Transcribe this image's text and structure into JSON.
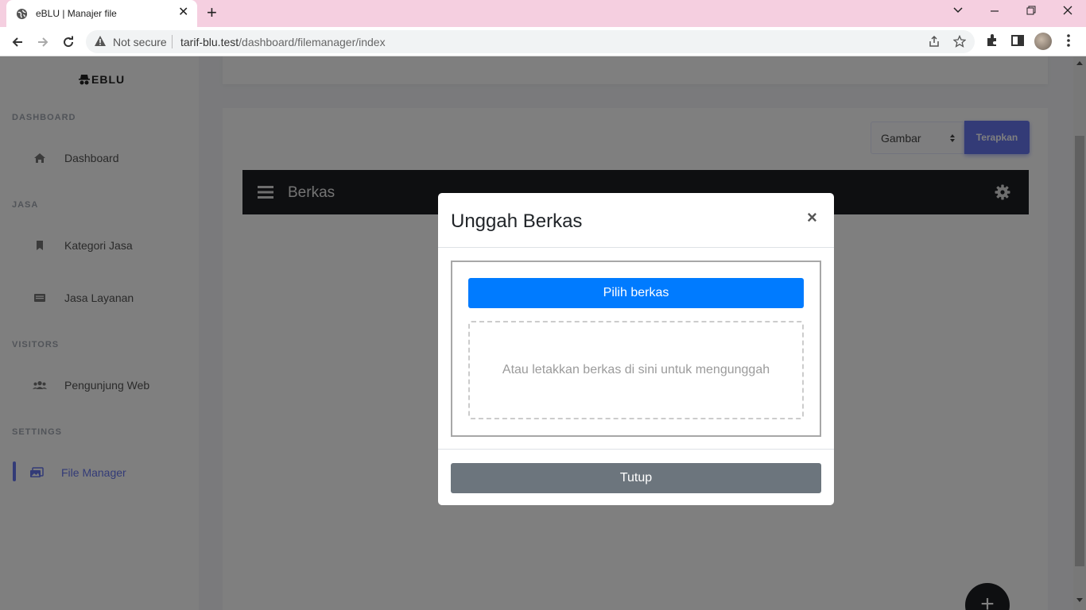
{
  "browser": {
    "tab_title": "eBLU | Manajer file",
    "tab_close": "✕",
    "new_tab": "+",
    "not_secure": "Not secure",
    "url_host": "tarif-blu.test",
    "url_path": "/dashboard/filemanager/index",
    "window_controls": {
      "dropdown": "⌄",
      "minimize": "—",
      "restore": "❐",
      "close": "✕"
    }
  },
  "sidebar": {
    "brand": "EBLU",
    "sections": [
      {
        "label": "DASHBOARD",
        "items": [
          {
            "label": "Dashboard",
            "icon": "home-icon"
          }
        ]
      },
      {
        "label": "JASA",
        "items": [
          {
            "label": "Kategori Jasa",
            "icon": "bookmark-icon"
          },
          {
            "label": "Jasa Layanan",
            "icon": "list-card-icon"
          }
        ]
      },
      {
        "label": "VISITORS",
        "items": [
          {
            "label": "Pengunjung Web",
            "icon": "users-icon"
          }
        ]
      },
      {
        "label": "SETTINGS",
        "items": [
          {
            "label": "File Manager",
            "icon": "images-icon",
            "active": true
          }
        ]
      }
    ]
  },
  "filter": {
    "selected": "Gambar",
    "apply_label": "Terapkan"
  },
  "file_manager": {
    "title": "Berkas",
    "fab_label": "+"
  },
  "modal": {
    "title": "Unggah Berkas",
    "close_symbol": "×",
    "pick_label": "Pilih berkas",
    "drop_text": "Atau letakkan berkas di sini untuk mengunggah",
    "close_label": "Tutup"
  },
  "colors": {
    "accent": "#6777ef",
    "primary": "#007bff",
    "secondary": "#6c757d",
    "tabbar": "#f5cfe0",
    "fm_header": "#1d1e22"
  }
}
